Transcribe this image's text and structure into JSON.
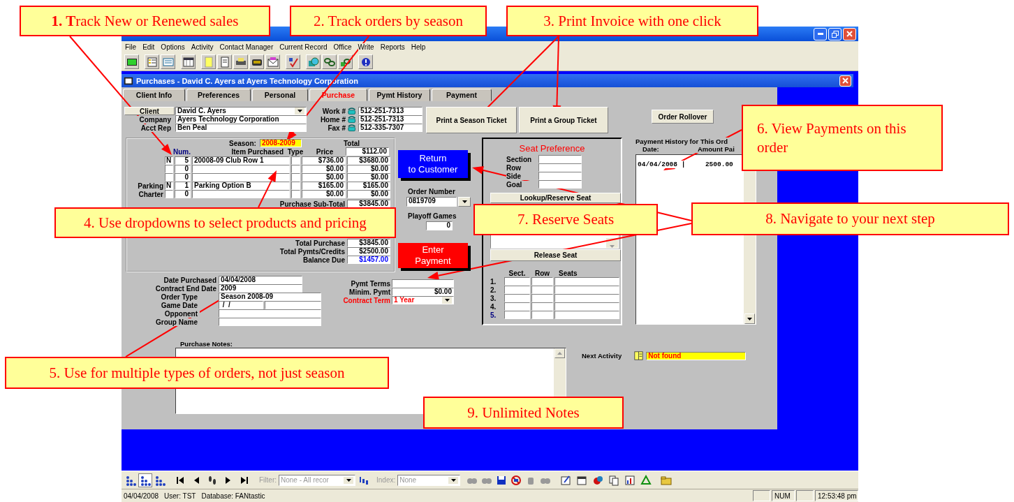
{
  "callouts": [
    {
      "text": "**1. T**rack New or Renewed sales"
    },
    {
      "text": "2. Track orders by season"
    },
    {
      "text": "3. Print Invoice with one click"
    },
    {
      "text": "4. Use dropdowns to select products and pricing"
    },
    {
      "text": "5. Use for multiple types of orders, not just season"
    },
    {
      "text": "6. View Payments on this order"
    },
    {
      "text": "7. Reserve Seats"
    },
    {
      "text": "8. Navigate to your next step"
    },
    {
      "text": "9. Unlimited Notes"
    }
  ],
  "menu": [
    "File",
    "Edit",
    "Options",
    "Activity",
    "Contact Manager",
    "Current Record",
    "Office",
    "Write",
    "Reports",
    "Help"
  ],
  "child_window": {
    "title": "Purchases - David C. Ayers at Ayers Technology Corporation"
  },
  "tabs": [
    {
      "label": "Client Info",
      "selected": false
    },
    {
      "label": "Preferences",
      "selected": false
    },
    {
      "label": "Personal",
      "selected": false
    },
    {
      "label": "Purchase",
      "selected": true
    },
    {
      "label": "Pymt History",
      "selected": false
    },
    {
      "label": "Payment",
      "selected": false
    }
  ],
  "client": {
    "button": "Client",
    "name": "David C. Ayers",
    "fields": [
      {
        "label": "Company",
        "value": "Ayers Technology Corporation"
      },
      {
        "label": "Acct Rep",
        "value": "Ben Peal"
      }
    ]
  },
  "phones": [
    {
      "label": "Work #",
      "value": "512-251-7313"
    },
    {
      "label": "Home #",
      "value": "512-251-7313"
    },
    {
      "label": "Fax #",
      "value": "512-335-7307"
    }
  ],
  "print_buttons": [
    "Print a Season Ticket",
    "Print a Group Ticket"
  ],
  "rollover_button": "Order Rollover",
  "purchase": {
    "season_label": "Season:",
    "season": "2008-2009",
    "total_label": "Total",
    "columns": [
      "Num.",
      "Item Purchased",
      "Type",
      "Price"
    ],
    "total_top": "$112.00",
    "rows": [
      {
        "flag": "N",
        "num": "5",
        "item": "20008-09 Club Row 1",
        "price": "$736.00",
        "total": "$3680.00"
      },
      {
        "num": "0",
        "price": "$0.00",
        "total": "$0.00"
      },
      {
        "num": "0",
        "price": "$0.00",
        "total": "$0.00"
      },
      {
        "label": "Parking",
        "flag": "N",
        "num": "1",
        "item": "Parking Option B",
        "price": "$165.00",
        "total": "$165.00"
      },
      {
        "label": "Charter",
        "num": "0",
        "price": "$0.00",
        "total": "$0.00"
      }
    ],
    "totals": [
      {
        "label": "Purchase Sub-Total",
        "value": "$3845.00",
        "highlight": false
      },
      {
        "label": "Total Purchase",
        "value": "$3845.00",
        "highlight": false
      },
      {
        "label": "Total Pymts/Credits",
        "value": "$2500.00",
        "highlight": false
      },
      {
        "label": "Balance Due",
        "value": "$1457.00",
        "highlight": true
      }
    ]
  },
  "order": {
    "return_button": [
      "Return",
      "to Customer"
    ],
    "number_label": "Order Number",
    "number": "0819709",
    "playoff_label": "Playoff Games",
    "playoff": "0",
    "payment_button": [
      "Enter",
      "Payment"
    ]
  },
  "dates": [
    {
      "label": "Date Purchased",
      "value": "04/04/2008",
      "kind": "text"
    },
    {
      "label": "Contract End Date",
      "value": "2009",
      "kind": "text"
    },
    {
      "label": "Order Type",
      "value": "Season 2008-09",
      "kind": "text"
    },
    {
      "label": "Game Date",
      "value": " /  /",
      "kind": "date"
    },
    {
      "label": "Opponent",
      "kind": "text"
    },
    {
      "label": "Group Name",
      "kind": "text"
    }
  ],
  "terms": [
    {
      "label": "Pymt Terms",
      "kind": "text"
    },
    {
      "label": "Minim. Pymt",
      "value": "$0.00",
      "kind": "amount"
    },
    {
      "label": "Contract Term",
      "value": "1 Year",
      "kind": "dropdown"
    }
  ],
  "seat": {
    "title": "Seat Preference",
    "fields": [
      "Section",
      "Row",
      "Side",
      "Goal"
    ],
    "lookup_button": "Lookup/Reserve Seat",
    "release_button": "Release Seat",
    "columns": [
      "Sect.",
      "Row",
      "Seats"
    ],
    "rows": [
      {
        "label": "1.",
        "highlight": false
      },
      {
        "label": "2.",
        "highlight": false
      },
      {
        "label": "3.",
        "highlight": false
      },
      {
        "label": "4.",
        "highlight": false
      },
      {
        "label": "5.",
        "highlight": true
      }
    ]
  },
  "payment_history": {
    "title": "Payment History for This Ord",
    "columns": [
      "Date:",
      "Amount Pai"
    ],
    "entries": [
      "04/04/2008 |     2500.00"
    ]
  },
  "notes": {
    "label": "Purchase Notes:"
  },
  "next_activity": {
    "label": "Next Activity",
    "value": "Not found"
  },
  "record_bar": {
    "filter_label": "Filter:",
    "filter": "None - All recor",
    "index_label": "Index:",
    "index": "None"
  },
  "status_bar": {
    "items": [
      "04/04/2008",
      "User: TST",
      "Database: FANtastic"
    ],
    "panels": [
      "NUM",
      "12:53:48 pm"
    ]
  }
}
